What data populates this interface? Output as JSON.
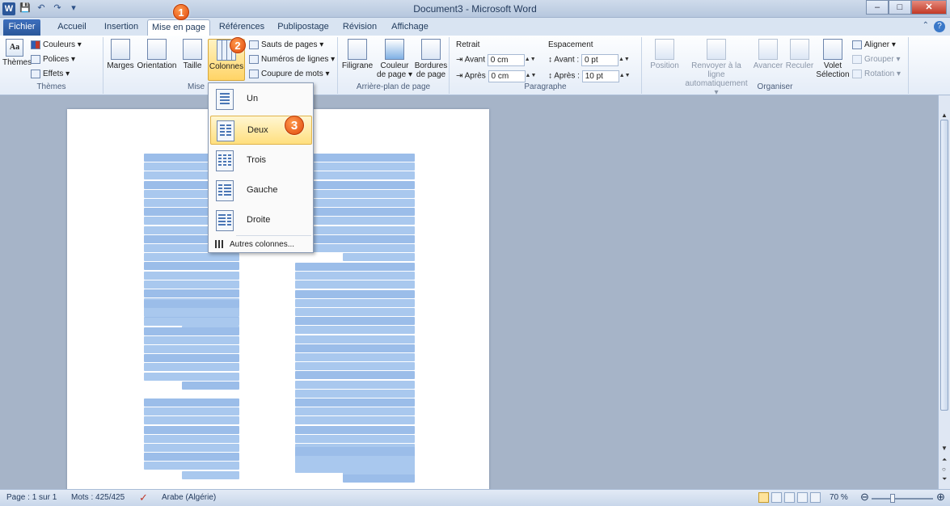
{
  "window": {
    "title": "Document3 - Microsoft Word",
    "app_icon": "W",
    "controls": [
      "–",
      "□",
      "✕"
    ]
  },
  "qat": [
    "💾",
    "↶",
    "↷",
    "▾"
  ],
  "tabs": [
    "Fichier",
    "Accueil",
    "Insertion",
    "Mise en page",
    "Références",
    "Publipostage",
    "Révision",
    "Affichage"
  ],
  "active_tab": "Mise en page",
  "ribbon": {
    "themes": {
      "themes_label": "Thèmes",
      "colors": "Couleurs ▾",
      "fonts": "Polices ▾",
      "effects": "Effets ▾",
      "group": "Thèmes"
    },
    "page_setup": {
      "margins": "Marges",
      "orientation": "Orientation",
      "size": "Taille",
      "columns": "Colonnes",
      "breaks": "Sauts de pages ▾",
      "line_numbers": "Numéros de lignes ▾",
      "hyphenation": "Coupure de mots ▾",
      "group": "Mise"
    },
    "background": {
      "watermark": "Filigrane",
      "page_color": "Couleur de page ▾",
      "borders": "Bordures de page",
      "group": "Arrière-plan de page"
    },
    "paragraph": {
      "indent_title": "Retrait",
      "before_label": "Avant",
      "before_value": "0 cm",
      "after_label": "Après",
      "after_value": "0 cm",
      "spacing_title": "Espacement",
      "sp_before_label": "Avant :",
      "sp_before_value": "0 pt",
      "sp_after_label": "Après :",
      "sp_after_value": "10 pt",
      "group": "Paragraphe"
    },
    "arrange": {
      "position": "Position",
      "wrap": "Renvoyer à la ligne automatiquement ▾",
      "forward": "Avancer",
      "backward": "Reculer",
      "pane": "Volet Sélection",
      "align": "Aligner ▾",
      "group_btn": "Grouper ▾",
      "rotate": "Rotation ▾",
      "group": "Organiser"
    }
  },
  "columns_menu": {
    "items": [
      "Un",
      "Deux",
      "Trois",
      "Gauche",
      "Droite"
    ],
    "selected": "Deux",
    "more": "Autres colonnes..."
  },
  "badges": [
    "1",
    "2",
    "3"
  ],
  "status": {
    "page": "Page : 1 sur 1",
    "words": "Mots : 425/425",
    "language": "Arabe (Algérie)",
    "zoom": "70 %"
  }
}
